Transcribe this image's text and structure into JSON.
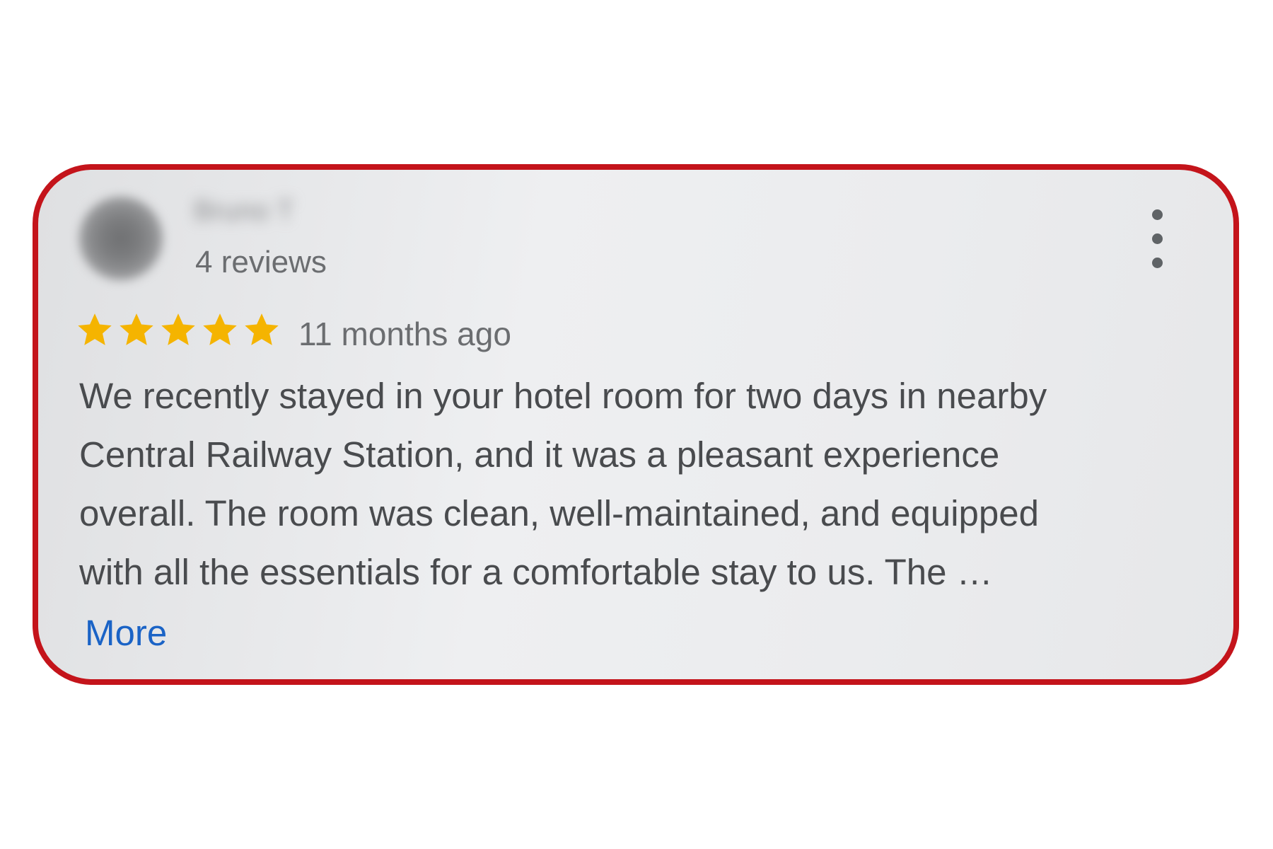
{
  "review": {
    "author_name": "Bruno T",
    "review_count": "4 reviews",
    "rating": 5,
    "rating_max": 5,
    "time_ago": "11 months ago",
    "text_lines": [
      "We recently stayed in your hotel room for two days in nearby",
      "Central Railway Station, and it was a pleasant experience",
      "overall. The room was clean, well-maintained, and equipped",
      "with all the essentials for a comfortable stay to us. The …"
    ],
    "more_label": "More"
  },
  "icons": {
    "avatar": "avatar-blurred",
    "menu": "more-vert-icon",
    "star": "star-icon"
  },
  "colors": {
    "frame_border": "#c4141b",
    "card_background": "#ebecee",
    "star": "#f5b400",
    "link": "#1a63c6",
    "text": "#494b4e",
    "muted_text": "#6b6d70"
  }
}
